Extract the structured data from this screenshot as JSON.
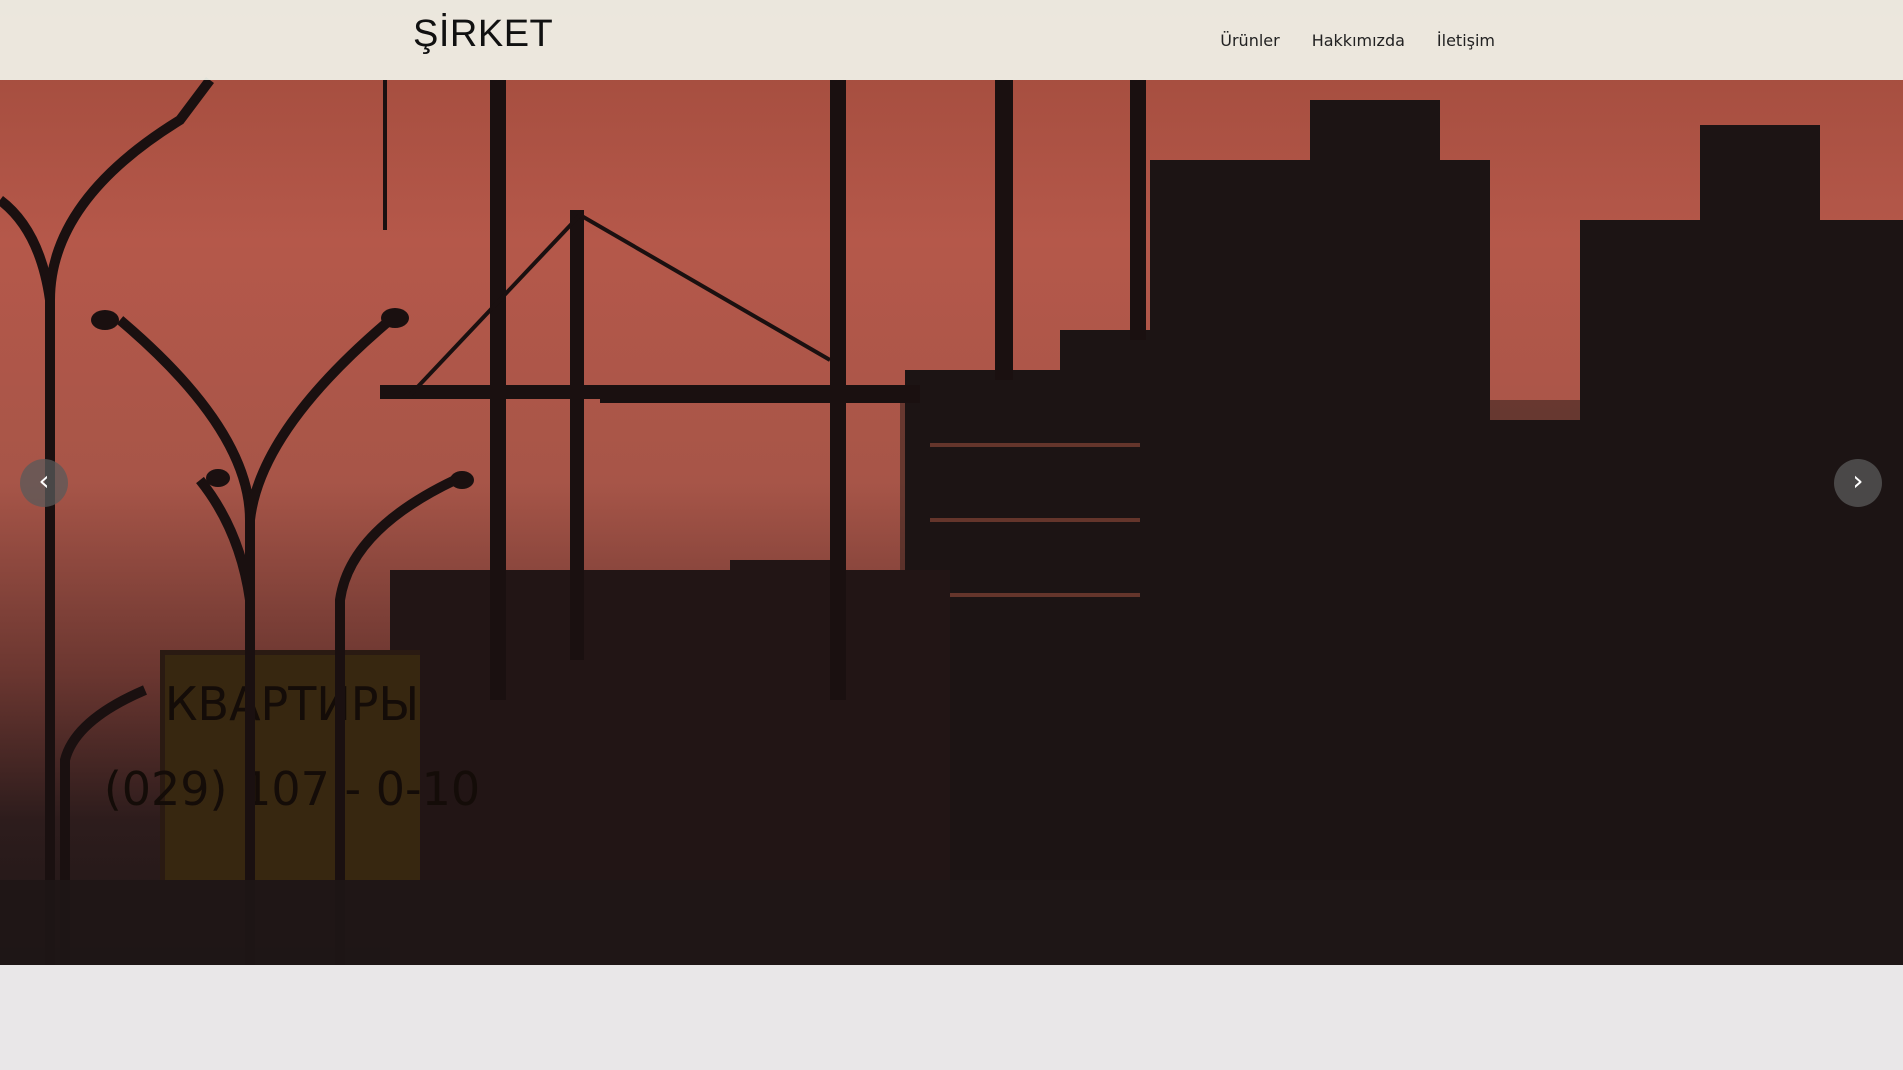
{
  "header": {
    "brand": "ŞİRKET",
    "nav": [
      {
        "label": "Ürünler"
      },
      {
        "label": "Hakkımızda"
      },
      {
        "label": "İletişim"
      }
    ]
  },
  "slider": {
    "prev_label": "‹",
    "next_label": "›",
    "image_description_icon": "construction-skyline-photo",
    "sign_text_line1": "КВАРТИРЫ",
    "sign_text_line2": "(029) 107 - 0-10"
  },
  "colors": {
    "navbar_bg": "#f1f3e9",
    "sky_top": "#a04a3b",
    "sky_mid": "#b5584a",
    "silhouette": "#1c1414",
    "page_bg": "#e9e7e8"
  }
}
